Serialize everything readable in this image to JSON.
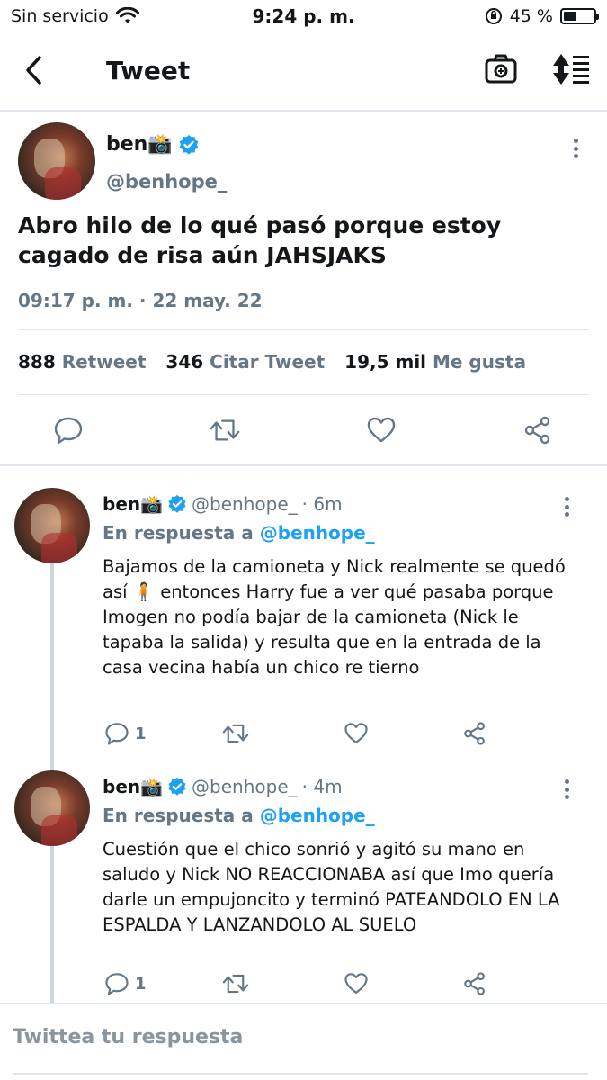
{
  "status_bar": {
    "carrier": "Sin servicio",
    "time": "9:24 p. m.",
    "battery_text": "45 %",
    "battery_level": 0.45
  },
  "nav": {
    "title": "Tweet",
    "back_icon": "chevron-left-icon",
    "camera_icon": "camera-icon",
    "sort_icon": "sort-icon"
  },
  "main_tweet": {
    "name": "ben📸",
    "handle": "@benhope_",
    "text": "Abro hilo de lo qué pasó porque estoy cagado de risa aún JAHSJAKS",
    "timestamp": "09:17 p. m. · 22 may. 22",
    "stats": [
      {
        "number": "888",
        "label": "Retweet"
      },
      {
        "number": "346",
        "label": "Citar Tweet"
      },
      {
        "number": "19,5 mil",
        "label": "Me gusta"
      }
    ]
  },
  "replies": [
    {
      "name": "ben📸",
      "handle": "@benhope_",
      "time": "· 6m",
      "reply_to_prefix": "En respuesta a",
      "reply_to_mention": "@benhope_",
      "text": "Bajamos de la camioneta y Nick realmente se quedó así 🧍 entonces Harry fue a ver qué pasaba porque Imogen no podía bajar de la camioneta (Nick le tapaba la salida) y resulta que en la entrada de la casa vecina había un chico re tierno",
      "reply_count": "1"
    },
    {
      "name": "ben📸",
      "handle": "@benhope_",
      "time": "· 4m",
      "reply_to_prefix": "En respuesta a",
      "reply_to_mention": "@benhope_",
      "text": "Cuestión que el chico sonrió y agitó su mano en saludo y Nick NO REACCIONABA así que Imo quería darle un empujoncito y terminó PATEANDOLO EN LA ESPALDA Y LANZANDOLO AL SUELO",
      "reply_count": "1"
    }
  ],
  "compose": {
    "placeholder": "Twittea tu respuesta"
  },
  "colors": {
    "accent": "#1da1f2",
    "secondary_text": "#657786",
    "divider": "#e1e8ed"
  }
}
